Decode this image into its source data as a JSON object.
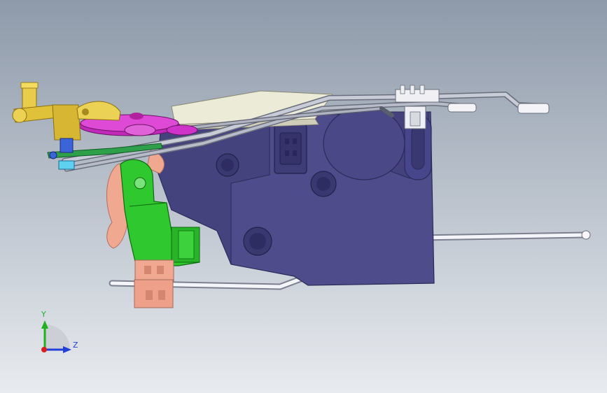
{
  "viewport": {
    "background_top": "#8e9aaa",
    "background_bottom": "#e8ebef"
  },
  "triad": {
    "y_label": "Y",
    "z_label": "Z",
    "y_color": "#1fb21f",
    "z_color": "#1f3fd8",
    "x_color": "#d81f1f"
  },
  "model": {
    "housing_color": "#4e4c8a",
    "housing_dark": "#3a3870",
    "lever_green": "#2fc82f",
    "gear_magenta": "#d033c8",
    "bracket_gold": "#e0c23a",
    "clip_salmon": "#f0a890",
    "rod_color": "#c8ccd6",
    "cover_color": "#ecebd8"
  }
}
